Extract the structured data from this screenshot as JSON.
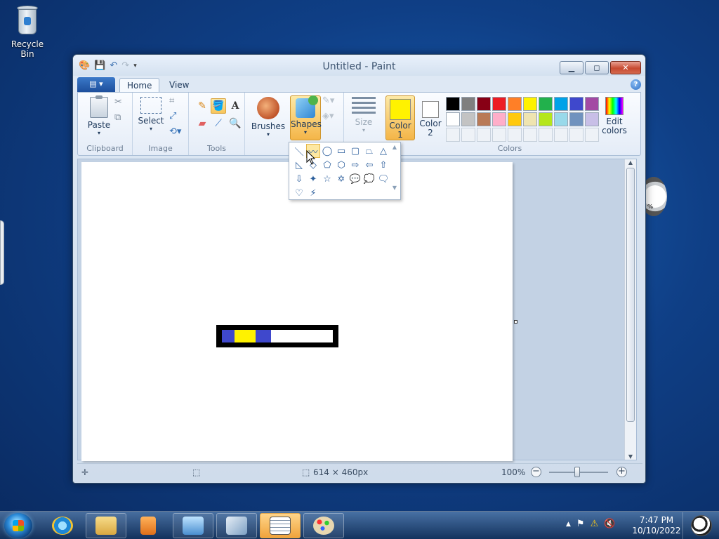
{
  "desktop": {
    "recycle_bin_label": "Recycle Bin",
    "gadget_text": "%"
  },
  "window": {
    "title": "Untitled - Paint",
    "qat_icons": [
      "paint-app-icon",
      "save-icon",
      "undo-icon",
      "redo-icon",
      "customize-icon"
    ],
    "buttons": {
      "minimize": "▁",
      "maximize": "◻",
      "close": "✕"
    }
  },
  "ribbon": {
    "menu_label": "▤ ▾",
    "tabs": [
      {
        "label": "Home",
        "active": true
      },
      {
        "label": "View",
        "active": false
      }
    ],
    "help_label": "?",
    "groups": {
      "clipboard": {
        "label": "Clipboard",
        "paste": "Paste"
      },
      "image": {
        "label": "Image",
        "select": "Select"
      },
      "tools": {
        "label": "Tools"
      },
      "brushes": {
        "label": "Brushes"
      },
      "shapes": {
        "label": "Shapes"
      },
      "size": {
        "label": "Size"
      },
      "colors": {
        "label": "Colors",
        "color1_label": "Color\n1",
        "color2_label": "Color\n2",
        "color1_value": "#FFF200",
        "color2_value": "#FFFFFF",
        "edit_label": "Edit\ncolors",
        "palette_row1": [
          "#000000",
          "#7F7F7F",
          "#880015",
          "#ED1C24",
          "#FF7F27",
          "#FFF200",
          "#22B14C",
          "#00A2E8",
          "#3F48CC",
          "#A349A4"
        ],
        "palette_row2": [
          "#FFFFFF",
          "#C3C3C3",
          "#B97A57",
          "#FFAEC9",
          "#FFC90E",
          "#EFE4B0",
          "#B5E61D",
          "#99D9EA",
          "#7092BE",
          "#C8BFE7"
        ]
      }
    }
  },
  "shapes_menu": {
    "items": [
      "＼",
      "〰",
      "◯",
      "▭",
      "▢",
      "⏢",
      "△",
      "◺",
      "◇",
      "⬠",
      "⬡",
      "⇨",
      "⇦",
      "⇧",
      "⇩",
      "✦",
      "☆",
      "✡",
      "💬",
      "💭",
      "🗨",
      "♡",
      "⚡"
    ],
    "hovered_index": 1,
    "scroll_up": "▲",
    "scroll_down": "▼"
  },
  "canvas": {
    "drawing_segments": [
      {
        "color": "#3F48CC"
      },
      {
        "color": "#FFF200"
      },
      {
        "color": "#3F48CC"
      },
      {
        "color": "#FFFFFF"
      }
    ]
  },
  "statusbar": {
    "move_icon": "✛",
    "selection_icon": "⬚",
    "size_icon": "⬚",
    "dimensions": "614 × 460px",
    "zoom": "100%",
    "zoom_out": "−",
    "zoom_in": "+"
  },
  "taskbar": {
    "apps": [
      "internet-explorer",
      "file-explorer",
      "media-player",
      "control-panel",
      "remote-desktop",
      "notepad",
      "paint"
    ],
    "tray": [
      "▲",
      "⚑",
      "⚠",
      "🔇"
    ],
    "time": "7:47 PM",
    "date": "10/10/2022"
  }
}
